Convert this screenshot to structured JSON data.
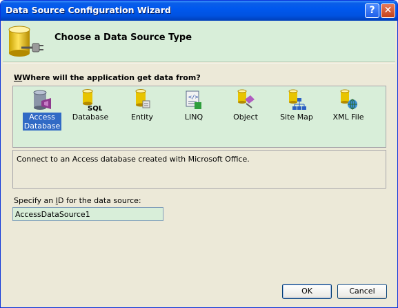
{
  "window": {
    "title": "Data Source Configuration Wizard",
    "help_glyph": "?",
    "close_glyph": "✕"
  },
  "banner": {
    "title": "Choose a Data Source Type",
    "icon": "database-connect-icon"
  },
  "question": {
    "text": "Where will the application get data from?"
  },
  "types": [
    {
      "label_line1": "Access",
      "label_line2": "Database",
      "icon": "access-database-icon",
      "selected": true
    },
    {
      "label_line1": "Database",
      "icon": "sql-database-icon"
    },
    {
      "label_line1": "Entity",
      "icon": "entity-icon"
    },
    {
      "label_line1": "LINQ",
      "icon": "linq-icon"
    },
    {
      "label_line1": "Object",
      "icon": "object-icon"
    },
    {
      "label_line1": "Site Map",
      "icon": "site-map-icon"
    },
    {
      "label_line1": "XML File",
      "icon": "xml-file-icon"
    }
  ],
  "description": {
    "text": "Connect to an Access database created with Microsoft Office."
  },
  "id_field": {
    "label_pre": "Specify an ",
    "label_key": "I",
    "label_post": "D for the data source:",
    "value": "AccessDataSource1"
  },
  "buttons": {
    "ok": "OK",
    "cancel": "Cancel"
  },
  "colors": {
    "titlebar": "#0054e3",
    "banner": "#d8eed9",
    "panel": "#d8eed9",
    "selection": "#316ac5",
    "dialog": "#ece9d8"
  }
}
